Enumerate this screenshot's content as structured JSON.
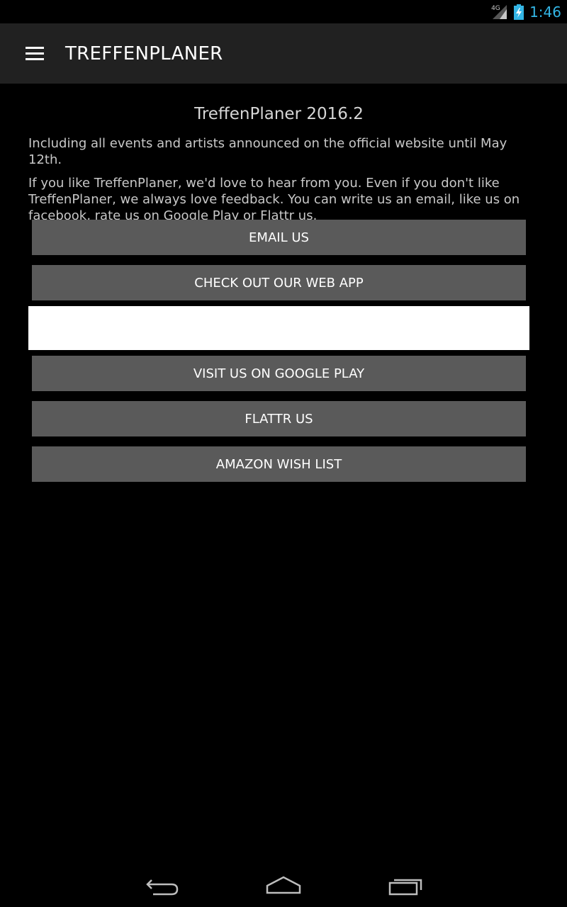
{
  "status_bar": {
    "network_type": "4G",
    "time": "1:46"
  },
  "action_bar": {
    "title": "TREFFENPLANER",
    "menu_icon": "hamburger-menu-icon"
  },
  "content": {
    "version": "TreffenPlaner 2016.2",
    "paragraph1": "Including all events and artists announced on the official website until May 12th.",
    "paragraph2": "If you like TreffenPlaner, we'd love to hear from you. Even if you don't like TreffenPlaner, we always love feedback. You can write us an email, like us on facebook, rate us on Google Play or Flattr us."
  },
  "buttons": {
    "email": "EMAIL US",
    "web_app": "CHECK OUT OUR WEB APP",
    "google_play": "VISIT US ON GOOGLE PLAY",
    "flattr": "FLATTR US",
    "amazon": "AMAZON WISH LIST"
  },
  "nav_bar": {
    "back_icon": "back-icon",
    "home_icon": "home-icon",
    "recent_icon": "recent-apps-icon"
  },
  "colors": {
    "accent_clock": "#33b5e5",
    "action_bar_bg": "#212121",
    "button_bg": "#5a5a5a",
    "background": "#000000"
  }
}
